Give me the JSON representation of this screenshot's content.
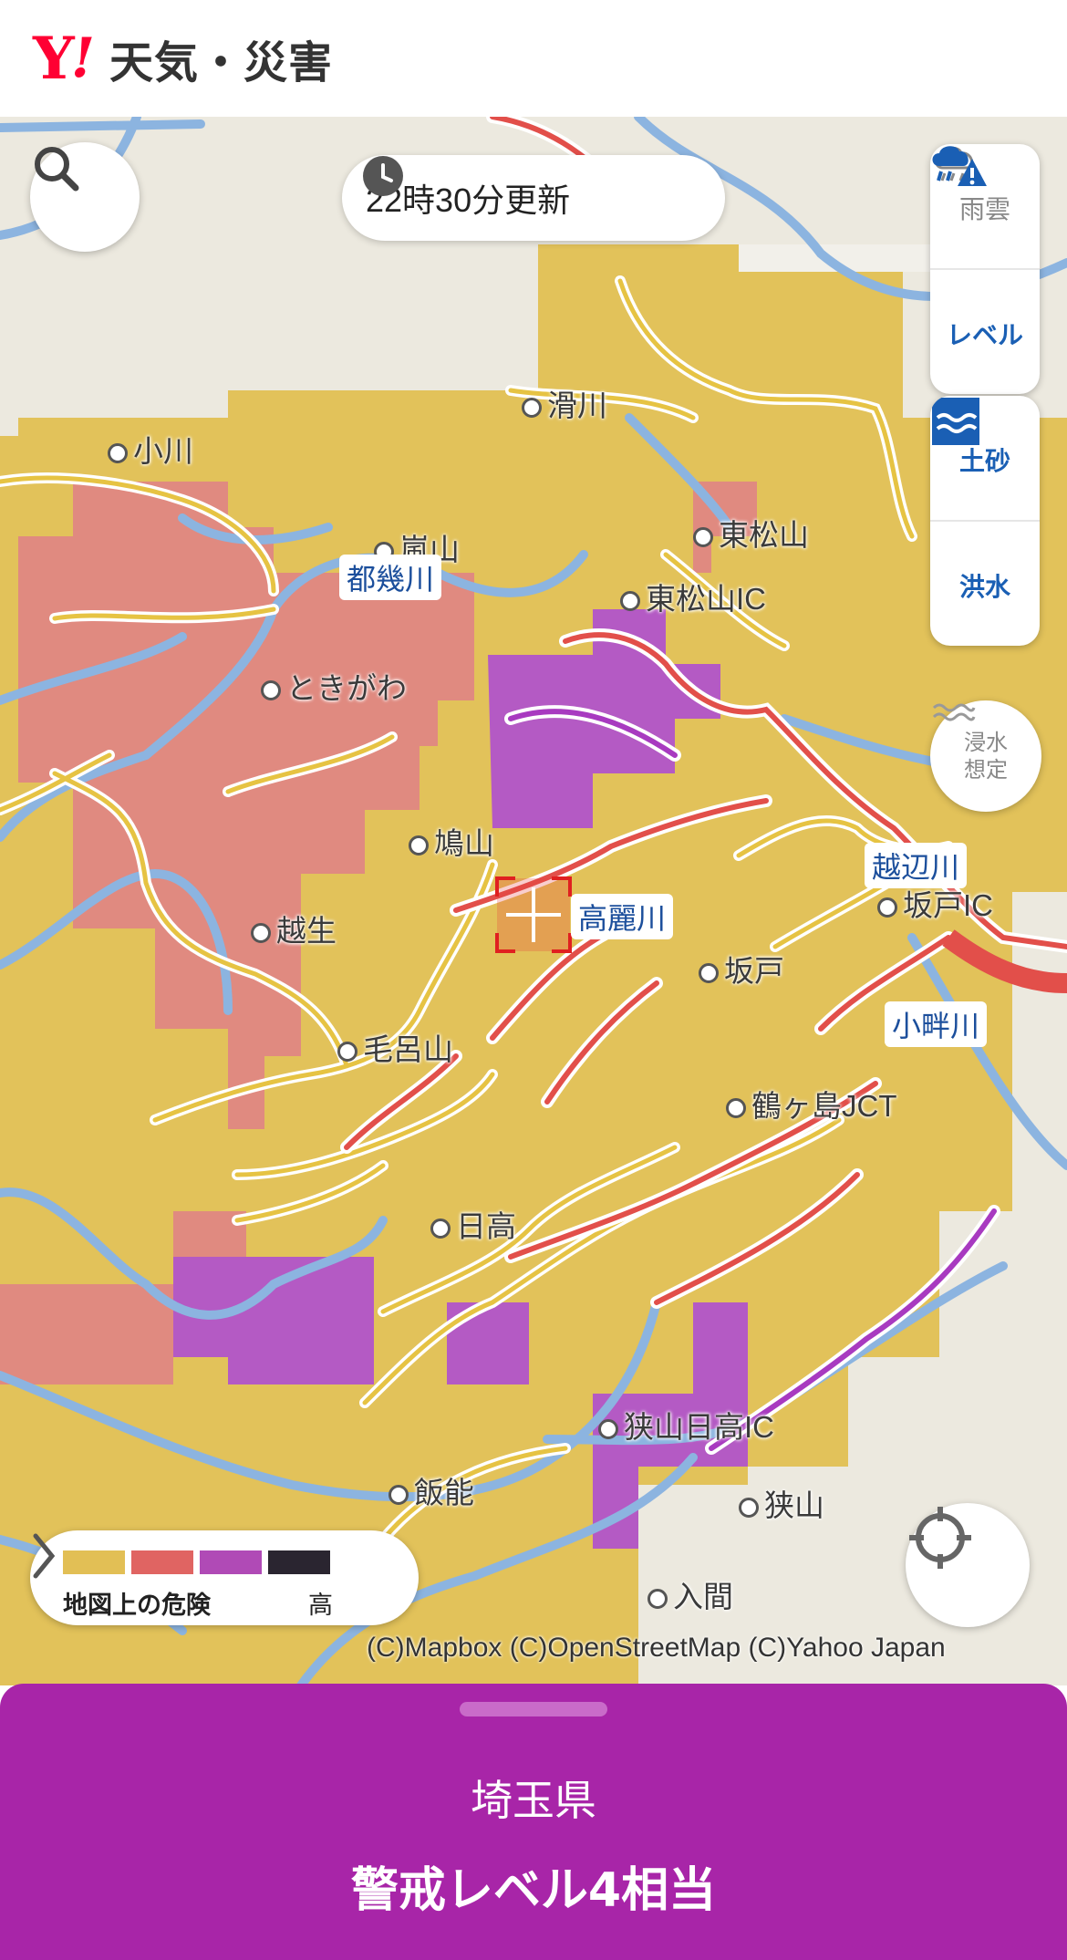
{
  "header": {
    "logo_y": "Y",
    "logo_mark": "!",
    "app_name": "天気・災害"
  },
  "map": {
    "update_time": "22時30分更新",
    "layers": {
      "rain": "雨雲",
      "level": "レベル",
      "landslide": "土砂",
      "flood": "洪水",
      "inundation": "浸水想定"
    },
    "places": {
      "ogawa": "小川",
      "namegawa": "滑川",
      "higashimatsuyama": "東松山",
      "arashiyama": "嵐山",
      "higashimatsuyama_ic": "東松山IC",
      "tokigawa": "ときがわ",
      "hatoyama": "鳩山",
      "ogose": "越生",
      "moroyama": "毛呂山",
      "sakado": "坂戸",
      "sakado_ic": "坂戸IC",
      "tsurugashima_jct": "鶴ヶ島JCT",
      "hidaka": "日高",
      "hanno": "飯能",
      "sayamahidaka_ic": "狭山日高IC",
      "sayama": "狭山",
      "iruma": "入間"
    },
    "rivers": {
      "tokigawa": "都幾川",
      "komagawa": "高麗川",
      "oppegawa": "越辺川",
      "koazegawa": "小畔川"
    },
    "attribution": "(C)Mapbox (C)OpenStreetMap (C)Yahoo Japan"
  },
  "legend": {
    "label": "地図上の危険",
    "high_label": "高",
    "colors": [
      "#e2bf55",
      "#e06462",
      "#b04ab6",
      "#2a2530"
    ]
  },
  "warning": {
    "region": "埼玉県",
    "level_text": "警戒レベル4相当",
    "color": "#a825a8"
  }
}
